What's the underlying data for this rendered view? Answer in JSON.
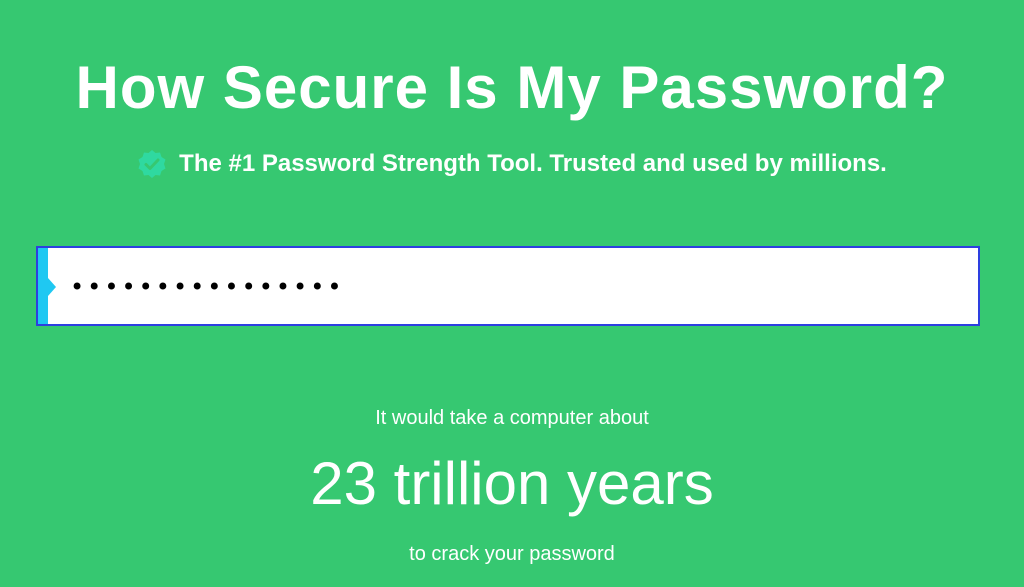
{
  "header": {
    "title": "How Secure Is My Password?",
    "subtitle": "The #1 Password Strength Tool. Trusted and used by millions.",
    "badge_icon": "verified-check-icon"
  },
  "password_field": {
    "value": "••••••••••••••••",
    "masked_length": 16
  },
  "result": {
    "pre_text": "It would take a computer about",
    "time": "23 trillion years",
    "post_text": "to crack your password"
  },
  "colors": {
    "background": "#36c871",
    "text": "#ffffff",
    "input_border": "#2d3fe0",
    "input_accent": "#1fc8f2",
    "badge": "#2fd9a0"
  }
}
